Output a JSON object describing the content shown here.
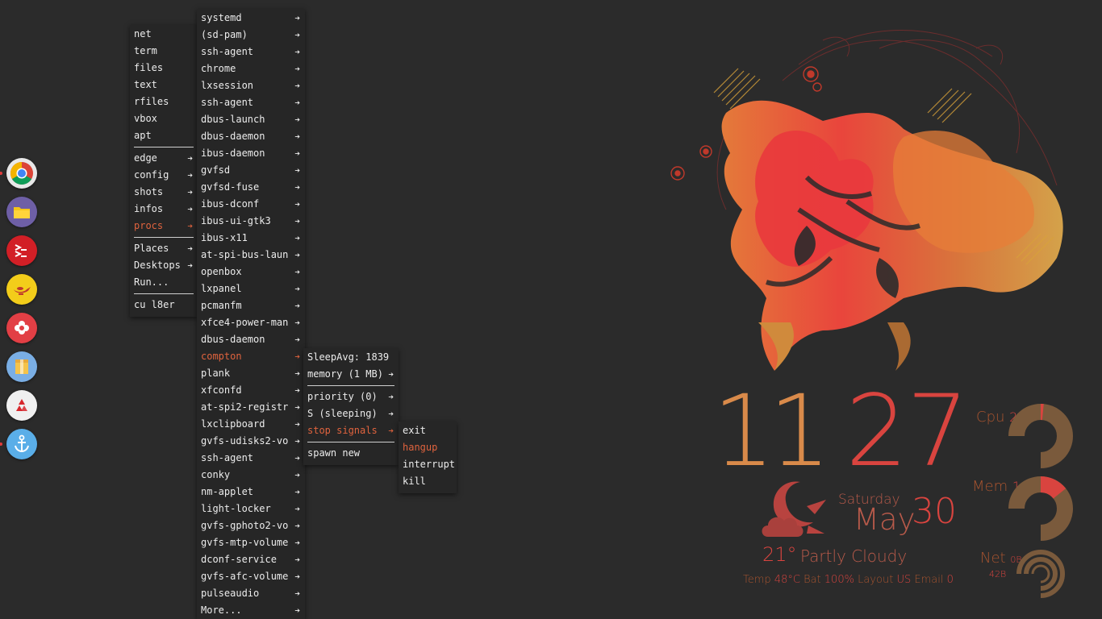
{
  "root_menu": {
    "items": [
      {
        "label": "net",
        "arrow": false
      },
      {
        "label": "term",
        "arrow": false
      },
      {
        "label": "files",
        "arrow": false
      },
      {
        "label": "text",
        "arrow": false
      },
      {
        "label": "rfiles",
        "arrow": false
      },
      {
        "label": "vbox",
        "arrow": false
      },
      {
        "label": "apt",
        "arrow": false
      },
      {
        "sep": true
      },
      {
        "label": "edge",
        "arrow": true
      },
      {
        "label": "config",
        "arrow": true
      },
      {
        "label": "shots",
        "arrow": true
      },
      {
        "label": "infos",
        "arrow": true
      },
      {
        "label": "procs",
        "arrow": true,
        "active": true
      },
      {
        "sep": true
      },
      {
        "label": "Places",
        "arrow": true
      },
      {
        "label": "Desktops",
        "arrow": true
      },
      {
        "label": "Run...",
        "arrow": false
      },
      {
        "sep": true
      },
      {
        "label": "cu l8er",
        "arrow": false
      }
    ]
  },
  "procs_menu": {
    "items": [
      "systemd",
      "(sd-pam)",
      "ssh-agent",
      "chrome",
      "lxsession",
      "ssh-agent",
      "dbus-launch",
      "dbus-daemon",
      "ibus-daemon",
      "gvfsd",
      "gvfsd-fuse",
      "ibus-dconf",
      "ibus-ui-gtk3",
      "ibus-x11",
      "at-spi-bus-laun",
      "openbox",
      "lxpanel",
      "pcmanfm",
      "xfce4-power-man",
      "dbus-daemon",
      "compton",
      "plank",
      "xfconfd",
      "at-spi2-registr",
      "lxclipboard",
      "gvfs-udisks2-vo",
      "ssh-agent",
      "conky",
      "nm-applet",
      "light-locker",
      "gvfs-gphoto2-vo",
      "gvfs-mtp-volume",
      "dconf-service",
      "gvfs-afc-volume",
      "pulseaudio",
      "More..."
    ],
    "active": "compton"
  },
  "compton_menu": {
    "items": [
      {
        "label": "SleepAvg: 1839",
        "arrow": false
      },
      {
        "label": "memory (1 MB)",
        "arrow": true
      },
      {
        "sep": true
      },
      {
        "label": "priority (0)",
        "arrow": true
      },
      {
        "label": "S (sleeping)",
        "arrow": true
      },
      {
        "label": "stop signals",
        "arrow": true,
        "active": true
      },
      {
        "sep": true
      },
      {
        "label": "spawn new",
        "arrow": false
      }
    ]
  },
  "signals_menu": {
    "items": [
      {
        "label": "exit"
      },
      {
        "label": "hangup",
        "active": true
      },
      {
        "label": "interrupt"
      },
      {
        "label": "kill"
      }
    ]
  },
  "dock": {
    "icons": [
      {
        "name": "chrome-icon",
        "bg": "#e8e8e8",
        "running": true
      },
      {
        "name": "files-icon",
        "bg": "#6e5fa6",
        "running": false
      },
      {
        "name": "terminal-icon",
        "bg": "#d21f26",
        "running": false
      },
      {
        "name": "genie-icon",
        "bg": "#f3cd1a",
        "running": false
      },
      {
        "name": "flower-app-icon",
        "bg": "#e23f45",
        "running": false
      },
      {
        "name": "archive-icon",
        "bg": "#7aaee4",
        "running": false
      },
      {
        "name": "trash-icon",
        "bg": "#f0f0f0",
        "running": false
      },
      {
        "name": "anchor-icon",
        "bg": "#5aaee8",
        "running": true
      }
    ]
  },
  "conky": {
    "hour": "11",
    "minute": "27",
    "weekday": "Saturday",
    "month": "May",
    "day": "30",
    "temperature": "21°",
    "condition": "Partly Cloudy",
    "status": {
      "temp_label": "Temp",
      "temp_value": "48°C",
      "bat_label": "Bat",
      "bat_value": "100%",
      "layout_label": "Layout",
      "layout_value": "US",
      "email_label": "Email",
      "email_value": "0"
    },
    "cpu": {
      "label": "Cpu",
      "value": "2%",
      "fraction": 0.02
    },
    "mem": {
      "label": "Mem",
      "value": "19%",
      "fraction": 0.19
    },
    "net": {
      "label": "Net",
      "down": "0B",
      "up": "42B"
    }
  },
  "colors": {
    "accent": "#e0633e",
    "red": "#d9443f",
    "brown": "#7a5a3c",
    "orange": "#e08a45"
  }
}
